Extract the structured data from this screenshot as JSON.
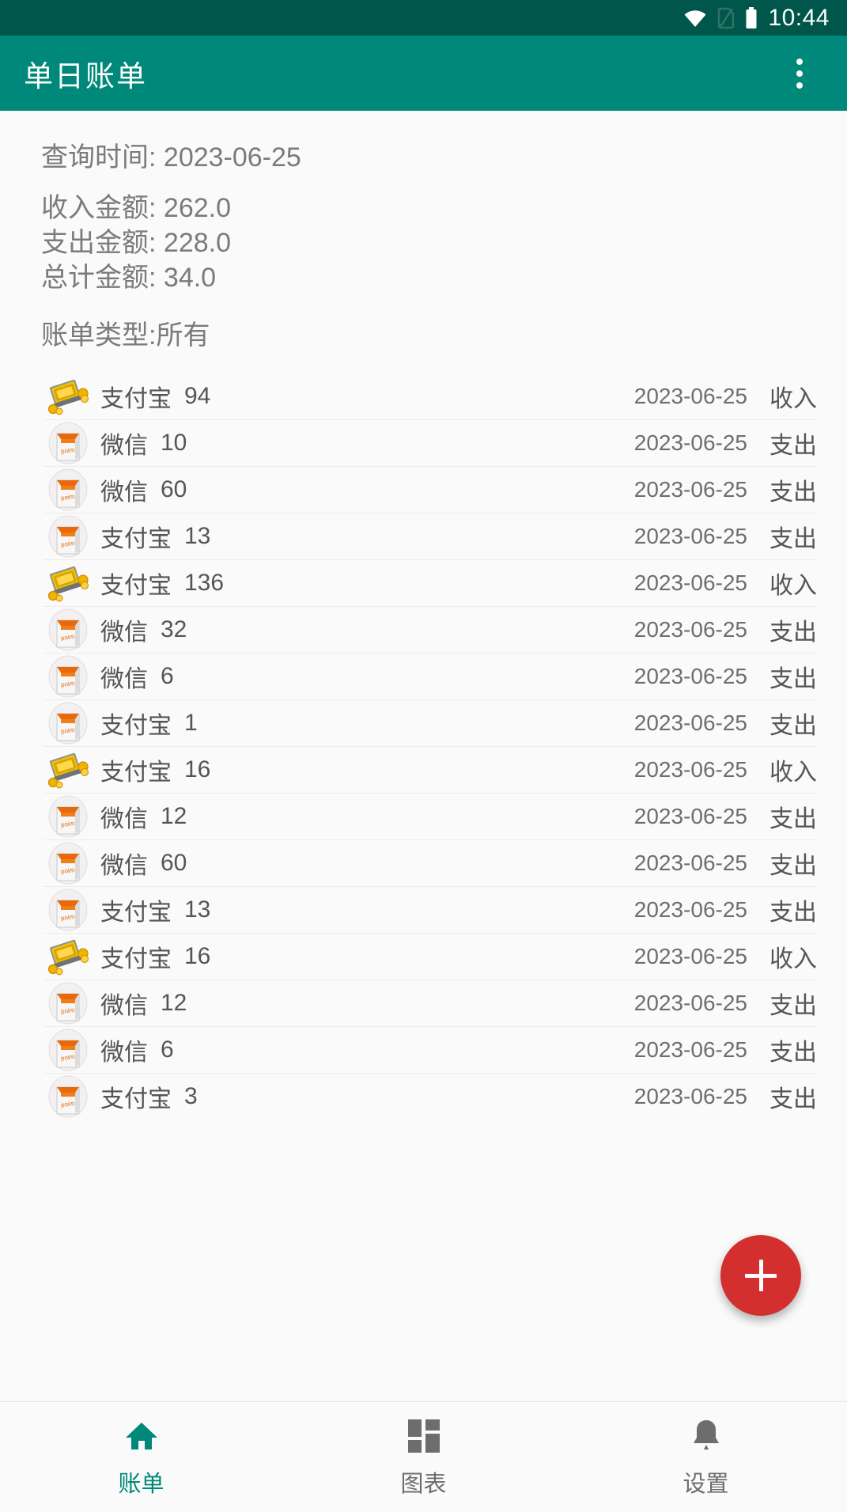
{
  "status_bar": {
    "time": "10:44",
    "icons": [
      "wifi-icon",
      "no-sim-icon",
      "battery-icon"
    ]
  },
  "app_bar": {
    "title": "单日账单",
    "overflow_menu": "overflow-menu-icon"
  },
  "summary": {
    "query_time_label": "查询时间:",
    "query_time_value": "2023-06-25",
    "income_label": "收入金额:",
    "income_value": "262.0",
    "expense_label": "支出金额:",
    "expense_value": "228.0",
    "total_label": "总计金额:",
    "total_value": "34.0",
    "bill_type_text": "账单类型:所有"
  },
  "list": {
    "rows": [
      {
        "icon": "money-stack-icon",
        "source": "支付宝",
        "amount": "94",
        "date": "2023-06-25",
        "type": "收入"
      },
      {
        "icon": "shopping-bag-icon",
        "source": "微信",
        "amount": "10",
        "date": "2023-06-25",
        "type": "支出"
      },
      {
        "icon": "shopping-bag-icon",
        "source": "微信",
        "amount": "60",
        "date": "2023-06-25",
        "type": "支出"
      },
      {
        "icon": "shopping-bag-icon",
        "source": "支付宝",
        "amount": "13",
        "date": "2023-06-25",
        "type": "支出"
      },
      {
        "icon": "money-stack-icon",
        "source": "支付宝",
        "amount": "136",
        "date": "2023-06-25",
        "type": "收入"
      },
      {
        "icon": "shopping-bag-icon",
        "source": "微信",
        "amount": "32",
        "date": "2023-06-25",
        "type": "支出"
      },
      {
        "icon": "shopping-bag-icon",
        "source": "微信",
        "amount": "6",
        "date": "2023-06-25",
        "type": "支出"
      },
      {
        "icon": "shopping-bag-icon",
        "source": "支付宝",
        "amount": "1",
        "date": "2023-06-25",
        "type": "支出"
      },
      {
        "icon": "money-stack-icon",
        "source": "支付宝",
        "amount": "16",
        "date": "2023-06-25",
        "type": "收入"
      },
      {
        "icon": "shopping-bag-icon",
        "source": "微信",
        "amount": "12",
        "date": "2023-06-25",
        "type": "支出"
      },
      {
        "icon": "shopping-bag-icon",
        "source": "微信",
        "amount": "60",
        "date": "2023-06-25",
        "type": "支出"
      },
      {
        "icon": "shopping-bag-icon",
        "source": "支付宝",
        "amount": "13",
        "date": "2023-06-25",
        "type": "支出"
      },
      {
        "icon": "money-stack-icon",
        "source": "支付宝",
        "amount": "16",
        "date": "2023-06-25",
        "type": "收入"
      },
      {
        "icon": "shopping-bag-icon",
        "source": "微信",
        "amount": "12",
        "date": "2023-06-25",
        "type": "支出"
      },
      {
        "icon": "shopping-bag-icon",
        "source": "微信",
        "amount": "6",
        "date": "2023-06-25",
        "type": "支出"
      },
      {
        "icon": "shopping-bag-icon",
        "source": "支付宝",
        "amount": "3",
        "date": "2023-06-25",
        "type": "支出"
      }
    ]
  },
  "fab": {
    "icon": "plus-icon",
    "color": "#d32f2f"
  },
  "bottom_nav": {
    "items": [
      {
        "label": "账单",
        "icon": "home-icon",
        "active": true
      },
      {
        "label": "图表",
        "icon": "dashboard-icon",
        "active": false
      },
      {
        "label": "设置",
        "icon": "bell-icon",
        "active": false
      }
    ]
  },
  "colors": {
    "status_bar": "#00564a",
    "app_bar": "#00887a",
    "accent": "#00887a",
    "fab": "#d32f2f",
    "page_bg": "#fafafa"
  }
}
